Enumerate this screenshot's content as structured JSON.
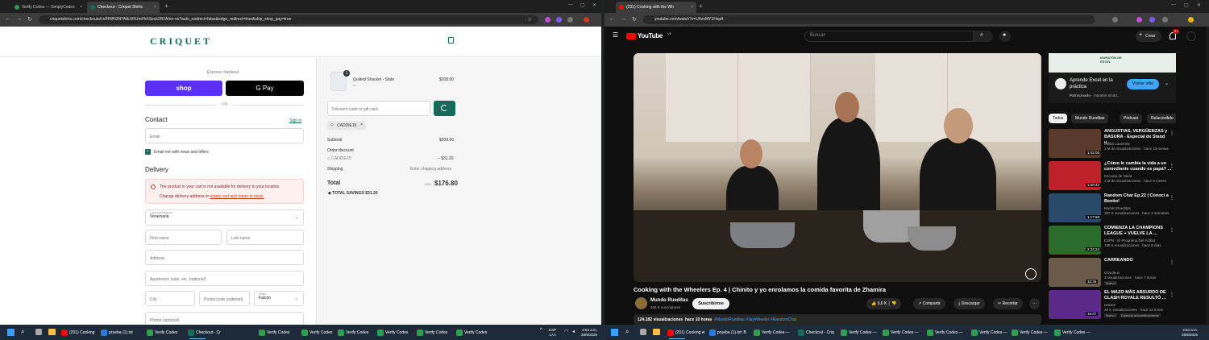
{
  "left_window": {
    "tabs": [
      {
        "title": "Verify Codes — SimplyCodes",
        "color": "#2e9e4f"
      },
      {
        "title": "Checkout - Criquet Shirts",
        "color": "#176a5b"
      }
    ],
    "url": "criquetshirts.com/checkouts/cn/HWN3NTAtEXRUmFhXSeck2R2A/en-ve?auto_redirect=false&edge_redirect=true&skip_shop_pay=true",
    "checkout": {
      "logo": "CRIQUET",
      "express_label": "Express checkout",
      "shop_pay_label": "shop",
      "gpay_label": "G Pay",
      "or_label": "OR",
      "contact_heading": "Contact",
      "sign_in": "Sign in",
      "email_placeholder": "Email",
      "newsletter_label": "Email me with news and offers",
      "delivery_heading": "Delivery",
      "warning_title": "The product in your cart is not available for delivery to your location.",
      "warning_prefix": "Change delivery address or ",
      "warning_link": "empty cart and return to store.",
      "country_label": "Country/Region",
      "country_value": "Venezuela",
      "first_name": "First name",
      "last_name": "Last name",
      "address": "Address",
      "apartment": "Apartment, suite, etc. (optional)",
      "city": "City",
      "postal": "Postal code (optional)",
      "state_label": "State",
      "state_value": "Falcón",
      "phone": "Phone (optional)"
    },
    "summary": {
      "qty": "1",
      "product_name": "Quilted Shacket - Slate",
      "product_variant": "S",
      "product_price": "$208.00",
      "discount_placeholder": "Discount code or gift card",
      "applied_code": "CADDIE15",
      "subtotal_label": "Subtotal",
      "subtotal_value": "$208.00",
      "order_discount_label": "Order discount",
      "discount_code": "CADDIE15",
      "discount_value": "– $31.20",
      "shipping_label": "Shipping",
      "shipping_value": "Enter shipping address",
      "total_label": "Total",
      "currency": "USD",
      "total_value": "$176.80",
      "savings_label": "TOTAL SAVINGS",
      "savings_value": "$31.20"
    }
  },
  "right_window": {
    "tabs": [
      {
        "title": "(201) Cooking with the Wh",
        "color": "#ff0000"
      }
    ],
    "url": "youtube.com/watch?v=U4znMY1HxpA",
    "youtube": {
      "logo_text": "YouTube",
      "country_code": "VE",
      "search_placeholder": "Buscar",
      "create_label": "Crear",
      "notif_count": "9+",
      "video_title": "Cooking with the Wheelers Ep. 4 | Chinito y yo enrolamos la comida favorita de Zhamira",
      "channel_name": "Mundo Rueditas",
      "subscribers": "466 K suscriptores",
      "subscribe_label": "Suscribirme",
      "likes": "9,6 K",
      "share_label": "Compartir",
      "download_label": "Descargar",
      "clip_label": "Recortar",
      "more_label": "···",
      "views": "124.182 visualizaciones",
      "age": "hace 10 horas",
      "hashtags": "#MundoRueditas #JayWheeler #RandomChat",
      "ad": {
        "title": "Aprende Excel en la práctica",
        "sponsored": "Patrocinado",
        "domain": "maratón.smart...",
        "cta": "Visitar sitio",
        "banner": "MARATÓN DE EXCEL"
      },
      "chips": [
        "Todos",
        "Mundo Rueditas",
        "Pódcast",
        "Relacionado"
      ],
      "recommendations": [
        {
          "title": "ANGUSTIAS, VERGÜENZAS y BASURA - Especial de Stand u...",
          "channel": "Lucas Lauriente",
          "meta": "1 M de visualizaciones · hace 13 meses",
          "duration": "1:02:06",
          "color": "#5a3a2a"
        },
        {
          "title": "¿Cómo le cambia la vida a un comediante cuando es papá? ...",
          "channel": "Escuela de Nada",
          "meta": "1 M de visualizaciones · hace 9 meses",
          "duration": "1:58:42",
          "color": "#c0202a"
        },
        {
          "title": "Random Chat Ep.22 | Conocí a Benito!",
          "channel": "Mundo Rueditas",
          "meta": "367 K visualizaciones · hace 2 semanas",
          "duration": "1:17:58",
          "color": "#2a4a6a"
        },
        {
          "title": "COMIENZA LA CHAMPIONS LEAGUE + VUELVE LA ...",
          "channel": "ESPN - El Programa Del Fútbol",
          "meta": "788 K visualizaciones · hace 9 días",
          "duration": "2:24:24",
          "color": "#2a6a2a"
        },
        {
          "title": "CARREANDO",
          "channel": "COLdeus",
          "meta": "3 visualizaciones · hace 7 horas",
          "duration": "16:36",
          "badge": "Nuevo",
          "color": "#6a5a4a"
        },
        {
          "title": "EL MAZO MÁS ABSURDO DE CLASH ROYALE RESULTÓ ...",
          "channel": "Kalo02",
          "meta": "30 K visualizaciones · hace 11 horas",
          "duration": "19:37",
          "badge": "Nuevo",
          "badge2": "Doblado automáticamente",
          "color": "#5a2a8a"
        }
      ]
    }
  },
  "taskbar": {
    "left_items": [
      {
        "label": "(201) Cooking",
        "color": "#ff0000"
      },
      {
        "label": "prueba (1).txt",
        "color": "#2b7bd8"
      },
      {
        "label": "Verify Codes",
        "color": "#2e9e4f"
      },
      {
        "label": "Checkout - Cr",
        "color": "#176a5b"
      },
      {
        "label": "Verify Codes",
        "color": "#2e9e4f"
      },
      {
        "label": "Verify Codes",
        "color": "#2e9e4f"
      },
      {
        "label": "Verify Codes",
        "color": "#2e9e4f"
      },
      {
        "label": "Verify Codes",
        "color": "#2e9e4f"
      },
      {
        "label": "Verify Codes",
        "color": "#2e9e4f"
      },
      {
        "label": "Verify Codes",
        "color": "#2e9e4f"
      },
      {
        "label": "Verify Codes",
        "color": "#2e9e4f"
      },
      {
        "label": "Verify Codes",
        "color": "#2e9e4f"
      }
    ],
    "lang_top": "ESP",
    "lang_bottom": "LAA",
    "time": "4:54 a.m.",
    "date": "28/9/2025",
    "right_items": [
      {
        "label": "(201) Cooking w",
        "color": "#ff0000"
      },
      {
        "label": "prueba (1).txt: B",
        "color": "#2b7bd8"
      },
      {
        "label": "Verify Codes —",
        "color": "#2e9e4f"
      },
      {
        "label": "Checkout - Criq",
        "color": "#176a5b"
      },
      {
        "label": "Verify Codes —",
        "color": "#2e9e4f"
      },
      {
        "label": "Verify Codes —",
        "color": "#2e9e4f"
      },
      {
        "label": "Verify Codes —",
        "color": "#2e9e4f"
      },
      {
        "label": "Verify Codes —",
        "color": "#2e9e4f"
      },
      {
        "label": "Verify Codes —",
        "color": "#2e9e4f"
      },
      {
        "label": "Verify Codes —",
        "color": "#2e9e4f"
      }
    ]
  }
}
